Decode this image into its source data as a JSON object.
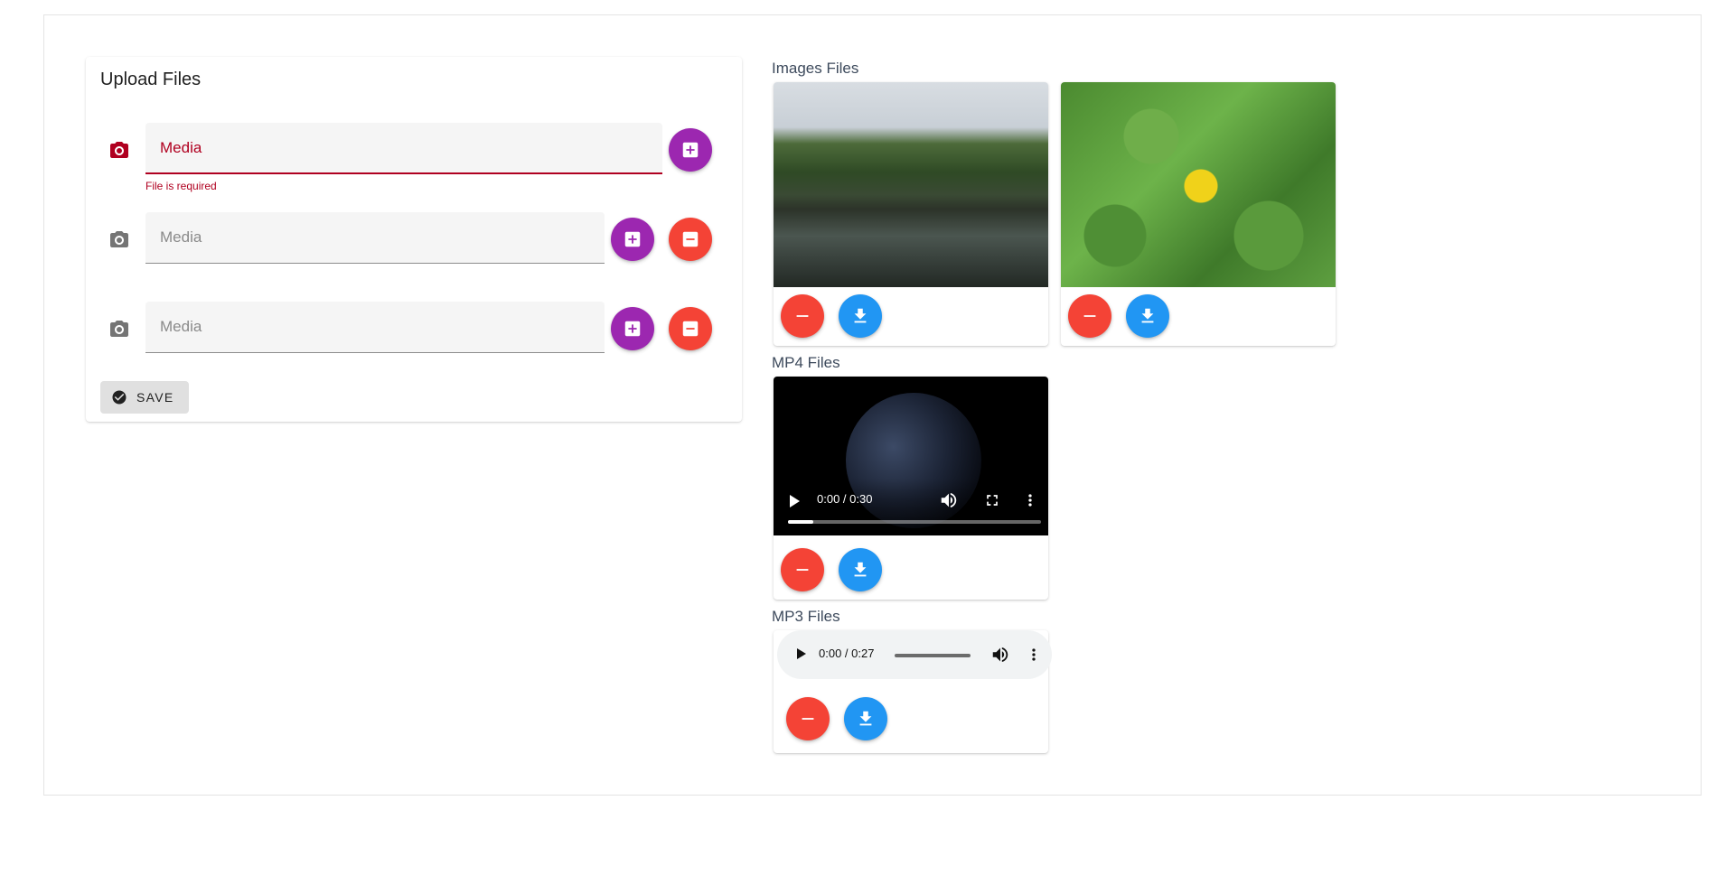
{
  "upload": {
    "title": "Upload Files",
    "fields": [
      {
        "placeholder": "Media",
        "value": "",
        "error": "File is required"
      },
      {
        "placeholder": "Media",
        "value": ""
      },
      {
        "placeholder": "Media",
        "value": ""
      }
    ],
    "save_label": "SAVE"
  },
  "sections": {
    "images_label": "Images Files",
    "mp4_label": "MP4 Files",
    "mp3_label": "MP3 Files"
  },
  "video": {
    "time": "0:00 / 0:30",
    "progress": 0.1
  },
  "audio": {
    "time": "0:00 / 0:27",
    "progress": 0
  },
  "colors": {
    "add": "#9c27b0",
    "remove": "#f44336",
    "download": "#2196f3",
    "error": "#b00020"
  },
  "icons": {
    "field": "camera-icon",
    "add": "add-box-icon",
    "remove": "remove-icon",
    "download": "download-icon",
    "save": "check-circle-icon"
  }
}
